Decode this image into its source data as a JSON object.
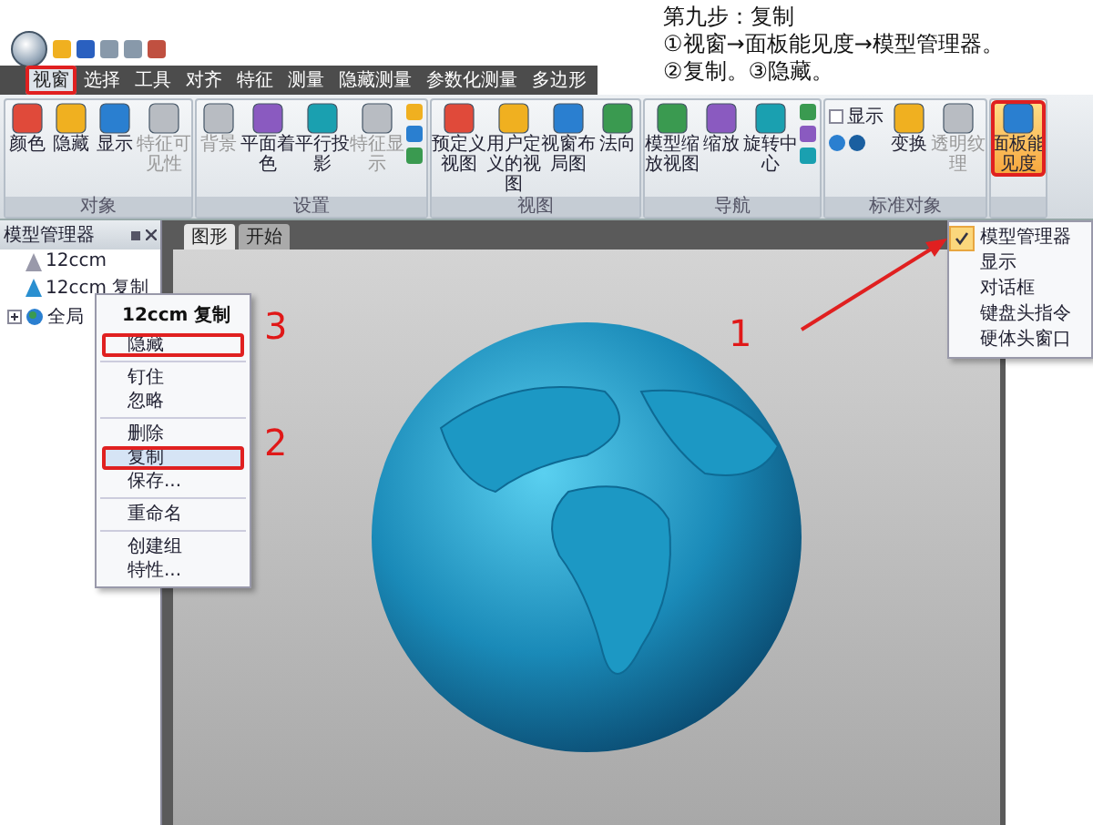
{
  "instruction": {
    "title": "第九步：复制",
    "lines": [
      "①视窗→面板能见度→模型管理器。",
      "②复制。③隐藏。"
    ]
  },
  "tabs": [
    {
      "label": "视窗",
      "selected": true,
      "highlighted": true
    },
    {
      "label": "选择",
      "selected": false,
      "highlighted": false
    },
    {
      "label": "工具",
      "selected": false,
      "highlighted": false
    },
    {
      "label": "对齐",
      "selected": false,
      "highlighted": false
    },
    {
      "label": "特征",
      "selected": false,
      "highlighted": false
    },
    {
      "label": "测量",
      "selected": false,
      "highlighted": false
    },
    {
      "label": "隐藏测量",
      "selected": false,
      "highlighted": false
    },
    {
      "label": "参数化测量",
      "selected": false,
      "highlighted": false
    },
    {
      "label": "多边形",
      "selected": false,
      "highlighted": false
    }
  ],
  "ribbon": {
    "groups": [
      {
        "label": "对象",
        "buttons": [
          {
            "kind": "large",
            "label": "颜色",
            "disabled": false
          },
          {
            "kind": "large",
            "label": "隐藏",
            "disabled": false
          },
          {
            "kind": "large",
            "label": "显示",
            "disabled": false
          },
          {
            "kind": "large",
            "label": "特征可见性",
            "disabled": true
          }
        ]
      },
      {
        "label": "设置",
        "buttons": [
          {
            "kind": "large",
            "label": "背景",
            "disabled": true
          },
          {
            "kind": "large",
            "label": "平面着色",
            "disabled": false
          },
          {
            "kind": "large",
            "label": "平行投影",
            "disabled": false
          },
          {
            "kind": "large",
            "label": "特征显示",
            "disabled": true
          },
          {
            "kind": "small"
          }
        ]
      },
      {
        "label": "视图",
        "buttons": [
          {
            "kind": "large",
            "label": "预定义视图",
            "disabled": false
          },
          {
            "kind": "large",
            "label": "用户定义的视图",
            "disabled": false
          },
          {
            "kind": "large",
            "label": "视窗布局图",
            "disabled": false
          },
          {
            "kind": "large",
            "label": "法向",
            "disabled": false
          }
        ]
      },
      {
        "label": "导航",
        "buttons": [
          {
            "kind": "large",
            "label": "模型缩放视图",
            "disabled": false
          },
          {
            "kind": "large",
            "label": "缩放",
            "disabled": false
          },
          {
            "kind": "large",
            "label": "旋转中心",
            "disabled": false
          },
          {
            "kind": "small"
          }
        ]
      },
      {
        "label": "标准对象",
        "buttons": [
          {
            "kind": "check",
            "label": "显示",
            "checked": false
          },
          {
            "kind": "large",
            "label": "变换",
            "disabled": false
          },
          {
            "kind": "large",
            "label": "透明纹理",
            "disabled": true
          }
        ]
      },
      {
        "buttons": [
          {
            "kind": "toggle",
            "label": "面板能见度",
            "active": true,
            "highlighted": true
          }
        ]
      }
    ]
  },
  "panel_menu": {
    "items": [
      {
        "label": "模型管理器",
        "checked": true
      },
      {
        "label": "显示",
        "checked": false
      },
      {
        "label": "对话框",
        "checked": false
      },
      {
        "label": "键盘头指令",
        "checked": false
      },
      {
        "label": "硬体头窗口",
        "checked": false
      }
    ]
  },
  "model_manager": {
    "title": "模型管理器",
    "items": [
      {
        "kind": "model",
        "label": "12ccm"
      },
      {
        "kind": "model",
        "label": "12ccm 复制"
      },
      {
        "kind": "group",
        "label": "全局",
        "expanded": false
      }
    ]
  },
  "context_menu": {
    "title": "12ccm 复制",
    "sections": [
      [
        {
          "label": "隐藏",
          "highlighted": true,
          "selected": false
        }
      ],
      [
        {
          "label": "钉住",
          "highlighted": false,
          "selected": false
        },
        {
          "label": "忽略",
          "highlighted": false,
          "selected": false
        }
      ],
      [
        {
          "label": "删除",
          "highlighted": false,
          "selected": false
        },
        {
          "label": "复制",
          "highlighted": true,
          "selected": true
        },
        {
          "label": "保存...",
          "highlighted": false,
          "selected": false
        }
      ],
      [
        {
          "label": "重命名",
          "highlighted": false,
          "selected": false
        }
      ],
      [
        {
          "label": "创建组",
          "highlighted": false,
          "selected": false
        },
        {
          "label": "特性...",
          "highlighted": false,
          "selected": false
        }
      ]
    ]
  },
  "viewport": {
    "tabs": [
      {
        "label": "图形",
        "selected": true
      },
      {
        "label": "开始",
        "selected": false
      }
    ]
  },
  "annotations": [
    "1",
    "2",
    "3"
  ]
}
